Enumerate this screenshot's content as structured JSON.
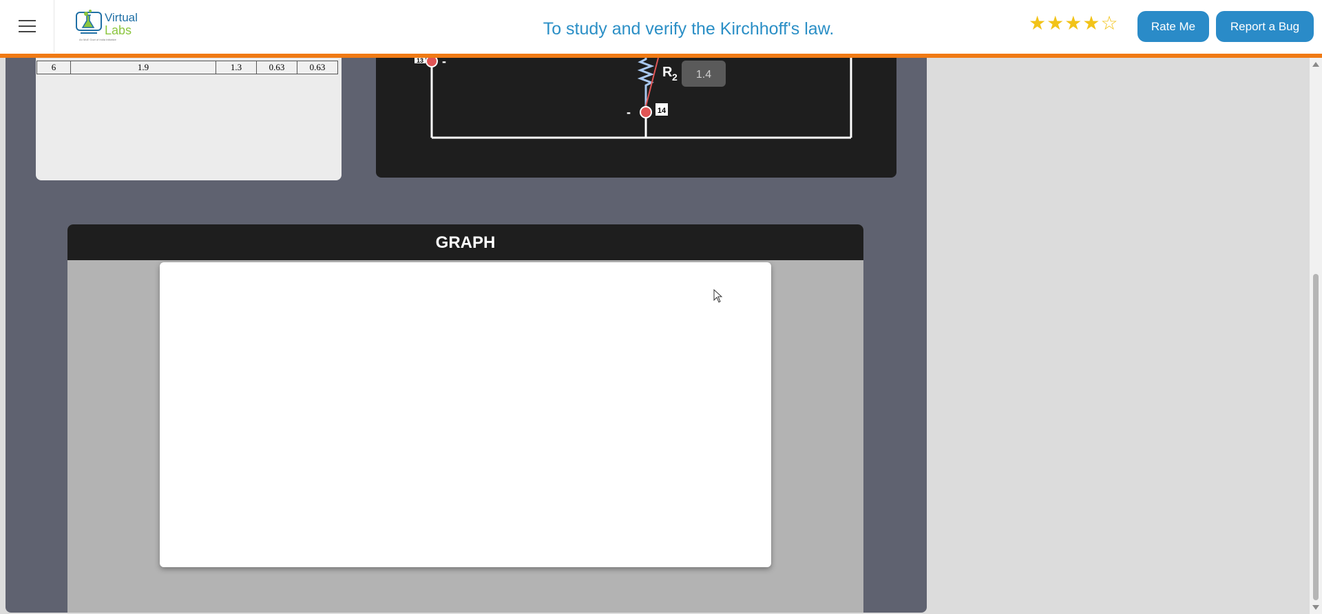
{
  "header": {
    "menu_icon": "hamburger-menu-icon",
    "logo": {
      "line1": "Virtual",
      "line2": "Labs",
      "tagline": "An MoE Govt of India Initiative"
    },
    "title": "To study and verify the Kirchhoff's law.",
    "rating": {
      "filled": 4,
      "total": 5
    },
    "rate_button": "Rate Me",
    "bug_button": "Report a Bug"
  },
  "colors": {
    "accent_orange": "#f07a14",
    "button_blue": "#2a8bc8",
    "title_blue": "#2b8fc6",
    "wire_red": "#e05555"
  },
  "table": {
    "rows": [
      [
        "6",
        "1.9",
        "1.3",
        "0.63",
        "0.63"
      ]
    ]
  },
  "circuit": {
    "left_node_label": "13",
    "resistor_label": "R",
    "resistor_subscript": "2",
    "resistor_value": "1.4",
    "bottom_node_label": "14",
    "minus_sign": "-"
  },
  "graph": {
    "title": "GRAPH"
  }
}
